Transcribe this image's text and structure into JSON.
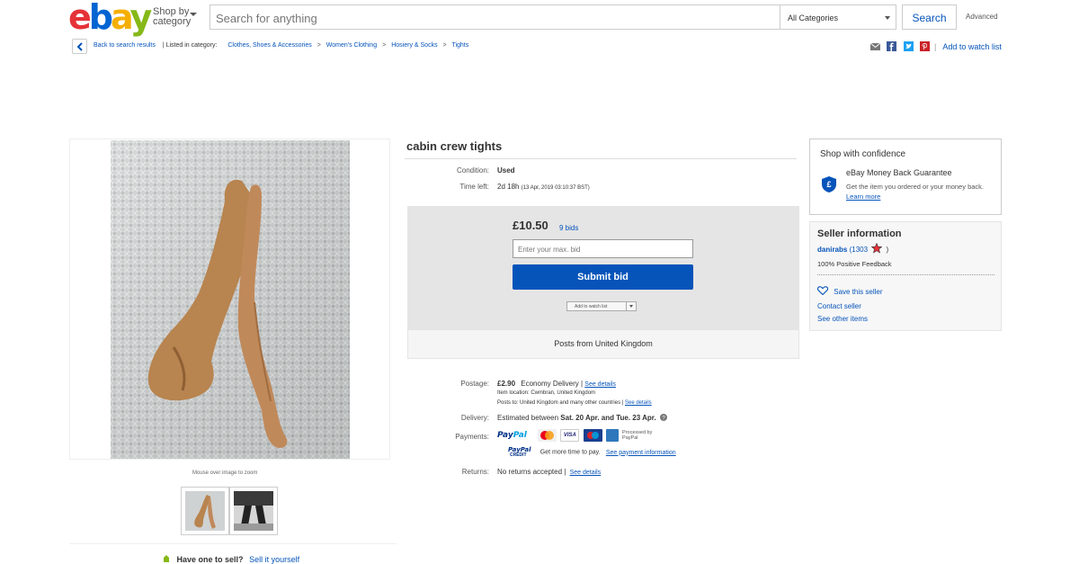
{
  "header": {
    "logo": {
      "e": "e",
      "b": "b",
      "a": "a",
      "y": "y"
    },
    "shop_by_line1": "Shop by",
    "shop_by_line2": "category",
    "search_placeholder": "Search for anything",
    "category_selected": "All Categories",
    "search_button": "Search",
    "advanced": "Advanced"
  },
  "breadcrumb": {
    "back": "Back to search results",
    "listed_in": "| Listed in category:",
    "items": [
      "Clothes, Shoes & Accessories",
      "Women's Clothing",
      "Hosiery & Socks",
      "Tights"
    ],
    "separator": ">",
    "add_to_watch_list": "Add to watch list",
    "bar": "|"
  },
  "gallery": {
    "zoom_hint": "Mouse over image to zoom",
    "sell_question": "Have one to sell?",
    "sell_link": "Sell it yourself"
  },
  "item": {
    "title": "cabin crew tights",
    "condition_label": "Condition:",
    "condition_value": "Used",
    "time_left_label": "Time left:",
    "time_left_value": "2d 18h",
    "time_left_detail": "(13 Apr, 2019  03:10:37 BST)",
    "price": "£10.50",
    "bids": "9 bids",
    "bid_placeholder": "Enter your max. bid",
    "submit_bid": "Submit bid",
    "add_to_watch_list": "Add to watch list",
    "posts_from": "Posts from United Kingdom",
    "postage_label": "Postage:",
    "postage_price": "£2.90",
    "postage_service": "Economy Delivery",
    "see_details": "See details",
    "item_location": "Item location:  Cwmbran, United Kingdom",
    "posts_to": "Posts to:  United Kingdom and many other countries",
    "delivery_label": "Delivery:",
    "delivery_text": "Estimated between",
    "delivery_dates": "Sat. 20 Apr. and Tue. 23 Apr.",
    "payments_label": "Payments:",
    "paypal_pay": "Pay",
    "paypal_pal": "Pal",
    "processed_by": "Processed by PayPal",
    "paypal_credit_top": "PayPal",
    "paypal_credit_bottom": "CREDIT",
    "credit_text": "Get more time to pay.",
    "see_payment_info": "See payment information",
    "returns_label": "Returns:",
    "returns_value": "No returns accepted",
    "pipe": "|"
  },
  "confidence": {
    "title": "Shop with confidence",
    "mbg_title": "eBay Money Back Guarantee",
    "mbg_desc": "Get the item you ordered or your money back.",
    "learn_more": "Learn more"
  },
  "seller": {
    "title": "Seller information",
    "name": "danirabs",
    "feedback_open": "(",
    "feedback_count": "1303",
    "feedback_close": ")",
    "positive": "100% Positive Feedback",
    "save": "Save this seller",
    "contact": "Contact seller",
    "other_items": "See other items"
  },
  "colors": {
    "accent": "#0654ba",
    "ebay_red": "#e53238",
    "ebay_blue": "#0064d2",
    "ebay_yellow": "#f5af02",
    "ebay_green": "#86b817"
  }
}
